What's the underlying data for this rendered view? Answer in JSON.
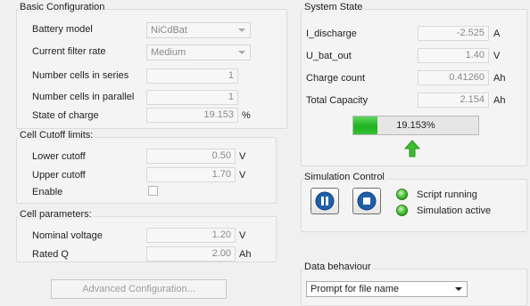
{
  "basic": {
    "title": "Basic Configuration",
    "battery_model_label": "Battery model",
    "battery_model_value": "NiCdBat",
    "filter_rate_label": "Current filter rate",
    "filter_rate_value": "Medium",
    "cells_series_label": "Number cells in series",
    "cells_series_value": "1",
    "cells_parallel_label": "Number cells in parallel",
    "cells_parallel_value": "1",
    "soc_label": "State of charge",
    "soc_value": "19.153",
    "soc_unit": "%"
  },
  "cutoff": {
    "title": "Cell Cutoff limits:",
    "lower_label": "Lower cutoff",
    "lower_value": "0.50",
    "lower_unit": "V",
    "upper_label": "Upper cutoff",
    "upper_value": "1.70",
    "upper_unit": "V",
    "enable_label": "Enable",
    "enable_checked": false
  },
  "cell_params": {
    "title": "Cell parameters:",
    "nominal_label": "Nominal voltage",
    "nominal_value": "1.20",
    "nominal_unit": "V",
    "rated_label": "Rated Q",
    "rated_value": "2.00",
    "rated_unit": "Ah"
  },
  "advanced_button": "Advanced Configuration...",
  "system_state": {
    "title": "System State",
    "discharge_label": "I_discharge",
    "discharge_value": "-2.525",
    "discharge_unit": "A",
    "ubat_label": "U_bat_out",
    "ubat_value": "1.40",
    "ubat_unit": "V",
    "charge_label": "Charge count",
    "charge_value": "0.41260",
    "charge_unit": "Ah",
    "capacity_label": "Total Capacity",
    "capacity_value": "2.154",
    "capacity_unit": "Ah",
    "progress_text": "19.153%",
    "progress_fraction": 0.19153,
    "arrow_icon": "up-arrow-icon",
    "arrow_color": "#3cbf2e"
  },
  "simulation": {
    "title": "Simulation Control",
    "pause_icon": "pause-icon",
    "stop_icon": "stop-icon",
    "button_icon_color": "#1f5fa8",
    "status1_label": "Script running",
    "status2_label": "Simulation active",
    "led_color": "#3dbb2b"
  },
  "data_behaviour": {
    "title": "Data behaviour",
    "selected": "Prompt for file name"
  }
}
